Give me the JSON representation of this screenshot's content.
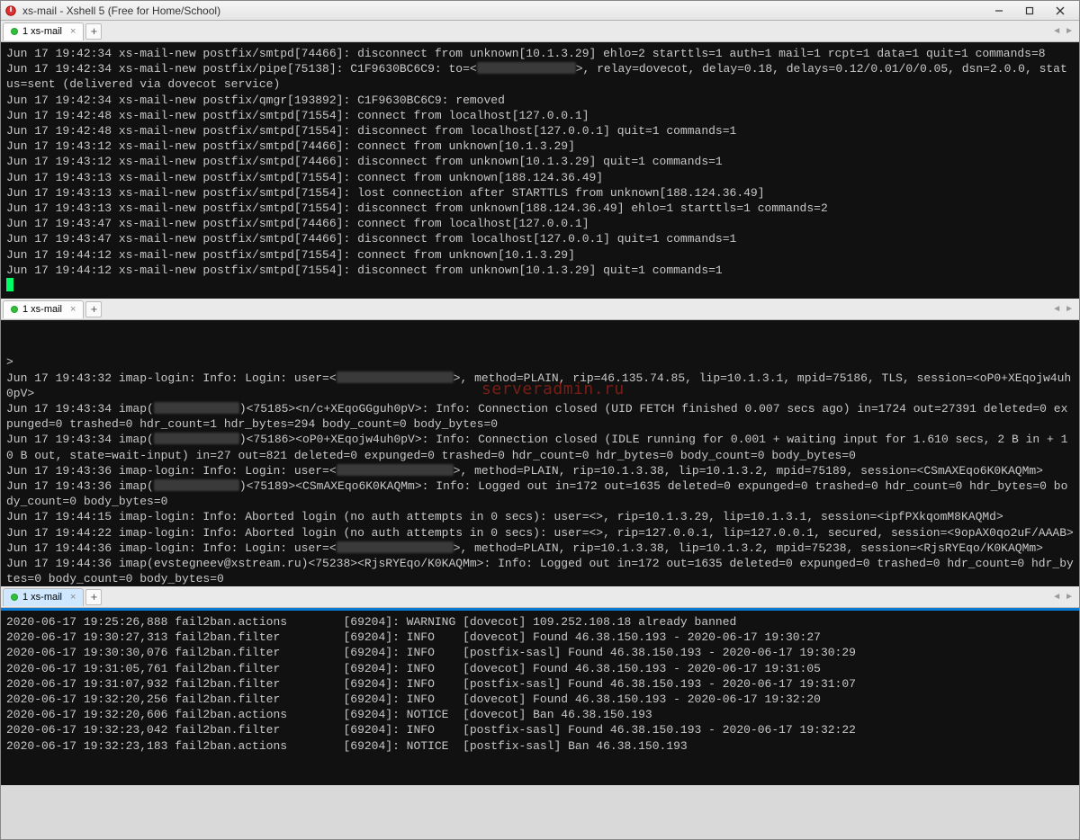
{
  "window": {
    "title": "xs-mail - Xshell 5 (Free for Home/School)"
  },
  "tabs": {
    "label": "1 xs-mail"
  },
  "watermark": "serveradmin.ru",
  "pane1": {
    "lines": [
      "Jun 17 19:42:34 xs-mail-new postfix/smtpd[74466]: disconnect from unknown[10.1.3.29] ehlo=2 starttls=1 auth=1 mail=1 rcpt=1 data=1 quit=1 commands=8",
      {
        "pre": "Jun 17 19:42:34 xs-mail-new postfix/pipe[75138]: C1F9630BC6C9: to=<",
        "blur": 110,
        "post": ">, relay=dovecot, delay=0.18, delays=0.12/0.01/0/0.05, dsn=2.0.0, status=sent (delivered via dovecot service)"
      },
      "Jun 17 19:42:34 xs-mail-new postfix/qmgr[193892]: C1F9630BC6C9: removed",
      "Jun 17 19:42:48 xs-mail-new postfix/smtpd[71554]: connect from localhost[127.0.0.1]",
      "Jun 17 19:42:48 xs-mail-new postfix/smtpd[71554]: disconnect from localhost[127.0.0.1] quit=1 commands=1",
      "Jun 17 19:43:12 xs-mail-new postfix/smtpd[74466]: connect from unknown[10.1.3.29]",
      "Jun 17 19:43:12 xs-mail-new postfix/smtpd[74466]: disconnect from unknown[10.1.3.29] quit=1 commands=1",
      "Jun 17 19:43:13 xs-mail-new postfix/smtpd[71554]: connect from unknown[188.124.36.49]",
      "Jun 17 19:43:13 xs-mail-new postfix/smtpd[71554]: lost connection after STARTTLS from unknown[188.124.36.49]",
      "Jun 17 19:43:13 xs-mail-new postfix/smtpd[71554]: disconnect from unknown[188.124.36.49] ehlo=1 starttls=1 commands=2",
      "Jun 17 19:43:47 xs-mail-new postfix/smtpd[74466]: connect from localhost[127.0.0.1]",
      "Jun 17 19:43:47 xs-mail-new postfix/smtpd[74466]: disconnect from localhost[127.0.0.1] quit=1 commands=1",
      "Jun 17 19:44:12 xs-mail-new postfix/smtpd[71554]: connect from unknown[10.1.3.29]",
      "Jun 17 19:44:12 xs-mail-new postfix/smtpd[71554]: disconnect from unknown[10.1.3.29] quit=1 commands=1"
    ]
  },
  "pane2": {
    "lines": [
      ">",
      {
        "pre": "Jun 17 19:43:32 imap-login: Info: Login: user=<",
        "blur": 130,
        "post": ">, method=PLAIN, rip=46.135.74.85, lip=10.1.3.1, mpid=75186, TLS, session=<oP0+XEqojw4uh0pV>"
      },
      {
        "pre": "Jun 17 19:43:34 imap(",
        "blur": 95,
        "post": ")<75185><n/c+XEqoGGguh0pV>: Info: Connection closed (UID FETCH finished 0.007 secs ago) in=1724 out=27391 deleted=0 expunged=0 trashed=0 hdr_count=1 hdr_bytes=294 body_count=0 body_bytes=0"
      },
      {
        "pre": "Jun 17 19:43:34 imap(",
        "blur": 95,
        "post": ")<75186><oP0+XEqojw4uh0pV>: Info: Connection closed (IDLE running for 0.001 + waiting input for 1.610 secs, 2 B in + 10 B out, state=wait-input) in=27 out=821 deleted=0 expunged=0 trashed=0 hdr_count=0 hdr_bytes=0 body_count=0 body_bytes=0"
      },
      {
        "pre": "Jun 17 19:43:36 imap-login: Info: Login: user=<",
        "blur": 130,
        "post": ">, method=PLAIN, rip=10.1.3.38, lip=10.1.3.2, mpid=75189, session=<CSmAXEqo6K0KAQMm>"
      },
      {
        "pre": "Jun 17 19:43:36 imap(",
        "blur": 95,
        "post": ")<75189><CSmAXEqo6K0KAQMm>: Info: Logged out in=172 out=1635 deleted=0 expunged=0 trashed=0 hdr_count=0 hdr_bytes=0 body_count=0 body_bytes=0"
      },
      "Jun 17 19:44:15 imap-login: Info: Aborted login (no auth attempts in 0 secs): user=<>, rip=10.1.3.29, lip=10.1.3.1, session=<ipfPXkqomM8KAQMd>",
      "Jun 17 19:44:22 imap-login: Info: Aborted login (no auth attempts in 0 secs): user=<>, rip=127.0.0.1, lip=127.0.0.1, secured, session=<9opAX0qo2uF/AAAB>",
      {
        "pre": "Jun 17 19:44:36 imap-login: Info: Login: user=<",
        "blur": 130,
        "post": ">, method=PLAIN, rip=10.1.3.38, lip=10.1.3.2, mpid=75238, session=<RjsRYEqo/K0KAQMm>"
      },
      "Jun 17 19:44:36 imap(evstegneev@xstream.ru)<75238><RjsRYEqo/K0KAQMm>: Info: Logged out in=172 out=1635 deleted=0 expunged=0 trashed=0 hdr_count=0 hdr_bytes=0 body_count=0 body_bytes=0"
    ]
  },
  "pane3": {
    "lines": [
      "2020-06-17 19:25:26,888 fail2ban.actions        [69204]: WARNING [dovecot] 109.252.108.18 already banned",
      "2020-06-17 19:30:27,313 fail2ban.filter         [69204]: INFO    [dovecot] Found 46.38.150.193 - 2020-06-17 19:30:27",
      "2020-06-17 19:30:30,076 fail2ban.filter         [69204]: INFO    [postfix-sasl] Found 46.38.150.193 - 2020-06-17 19:30:29",
      "2020-06-17 19:31:05,761 fail2ban.filter         [69204]: INFO    [dovecot] Found 46.38.150.193 - 2020-06-17 19:31:05",
      "2020-06-17 19:31:07,932 fail2ban.filter         [69204]: INFO    [postfix-sasl] Found 46.38.150.193 - 2020-06-17 19:31:07",
      "2020-06-17 19:32:20,256 fail2ban.filter         [69204]: INFO    [dovecot] Found 46.38.150.193 - 2020-06-17 19:32:20",
      "2020-06-17 19:32:20,606 fail2ban.actions        [69204]: NOTICE  [dovecot] Ban 46.38.150.193",
      "2020-06-17 19:32:23,042 fail2ban.filter         [69204]: INFO    [postfix-sasl] Found 46.38.150.193 - 2020-06-17 19:32:22",
      "2020-06-17 19:32:23,183 fail2ban.actions        [69204]: NOTICE  [postfix-sasl] Ban 46.38.150.193"
    ]
  }
}
